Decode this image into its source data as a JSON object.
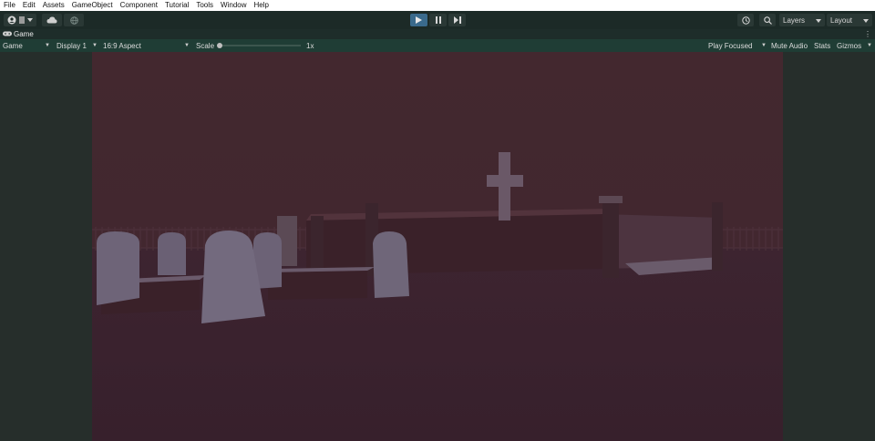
{
  "menubar": {
    "items": [
      "File",
      "Edit",
      "Assets",
      "GameObject",
      "Component",
      "Tutorial",
      "Tools",
      "Window",
      "Help"
    ]
  },
  "toolbar": {
    "account_icon": "account-icon",
    "cloud_icon": "cloud-icon",
    "collab_icon": "collab-icon",
    "play_icon": "play-icon",
    "pause_icon": "pause-icon",
    "step_icon": "step-icon",
    "history_icon": "history-icon",
    "search_icon": "search-icon",
    "layers_label": "Layers",
    "layout_label": "Layout",
    "accent_color": "#3a6a8c"
  },
  "tab": {
    "label": "Game",
    "icon": "gamepad-icon",
    "more_icon": "⋮"
  },
  "gamebar": {
    "mode_label": "Game",
    "display_label": "Display 1",
    "aspect_label": "16:9 Aspect",
    "scale_label": "Scale",
    "scale_value": "1x",
    "scale_level": 0.0,
    "play_focused_label": "Play Focused",
    "mute_audio_label": "Mute Audio",
    "stats_label": "Stats",
    "gizmos_label": "Gizmos"
  },
  "scene": {
    "description_colors": {
      "sky": "#3f262f",
      "ground": "#3a2430",
      "stone": "#6c6678"
    }
  }
}
